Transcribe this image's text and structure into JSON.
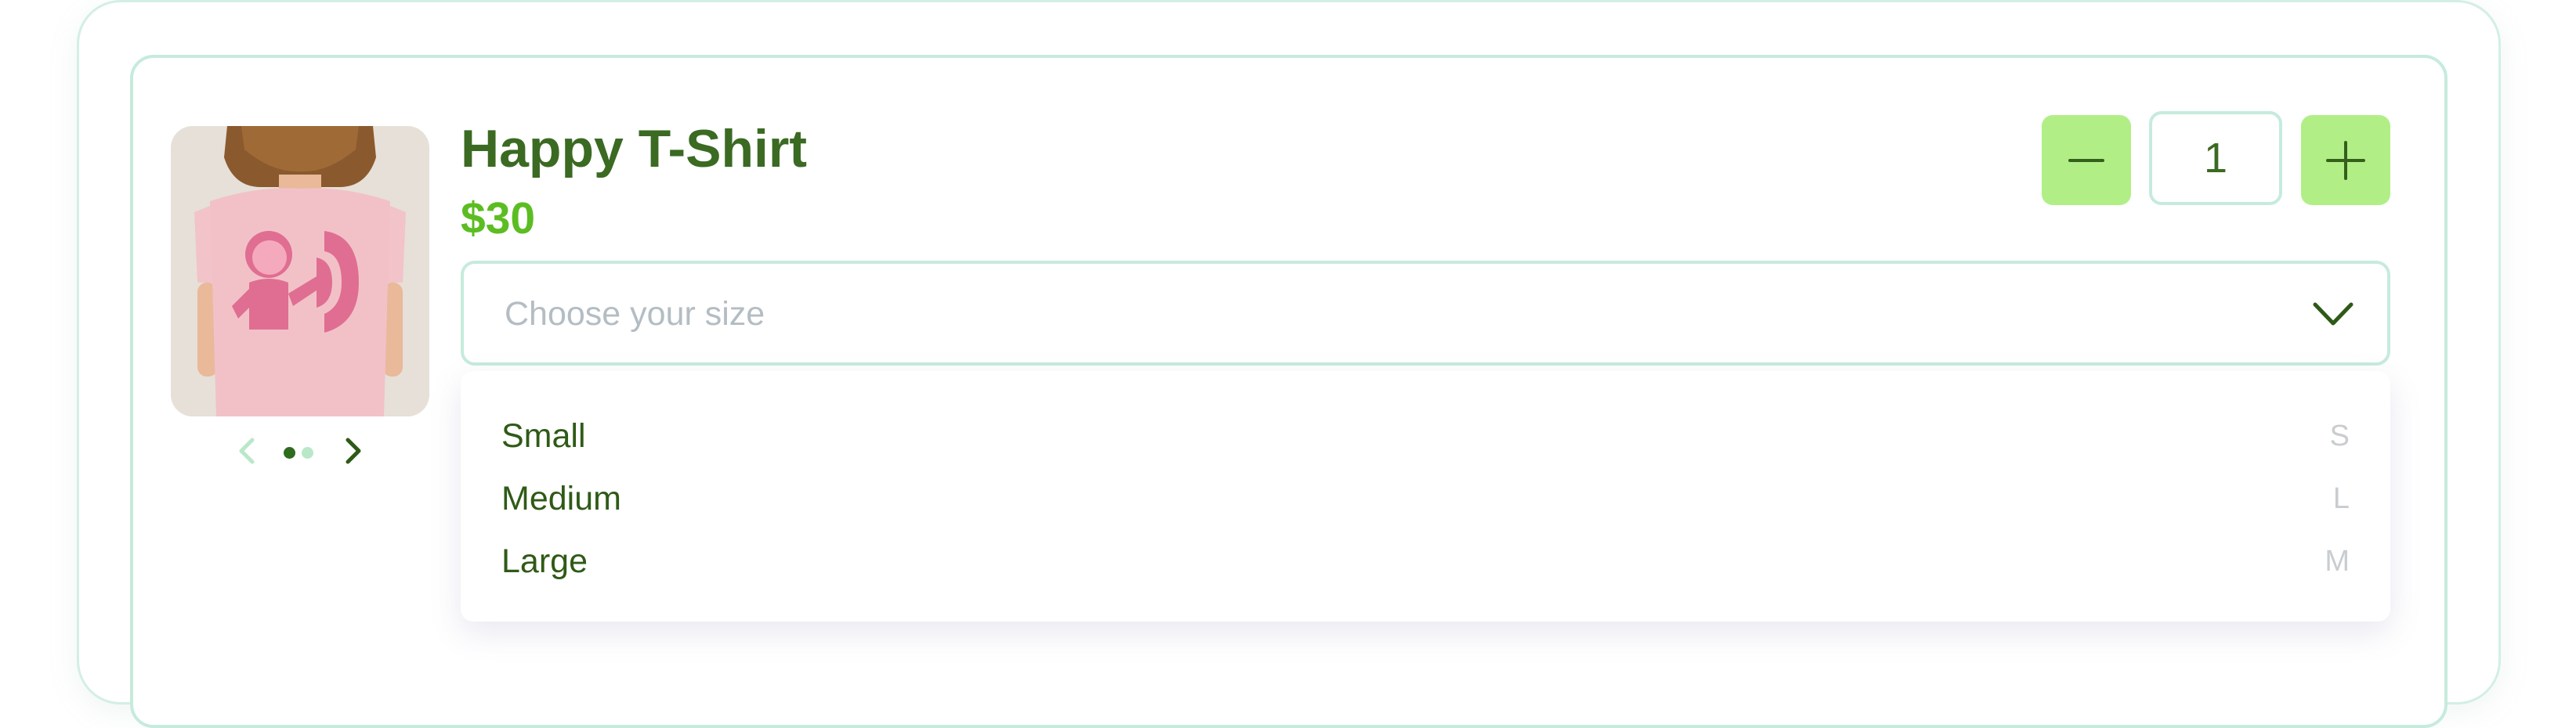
{
  "product": {
    "title": "Happy T-Shirt",
    "price": "$30",
    "image_icon": "pink-t-shirt-photo"
  },
  "carousel": {
    "prev_icon": "chevron-left-icon",
    "next_icon": "chevron-right-icon",
    "dot_count": 2,
    "active_index": 0
  },
  "quantity": {
    "value": "1",
    "minus_icon": "minus-icon",
    "plus_icon": "plus-icon"
  },
  "size_select": {
    "placeholder": "Choose your size",
    "chevron_icon": "chevron-down-icon",
    "options": [
      {
        "label": "Small",
        "code": "S"
      },
      {
        "label": "Medium",
        "code": "L"
      },
      {
        "label": "Large",
        "code": "M"
      }
    ]
  },
  "colors": {
    "title": "#3b6a22",
    "price": "#5cbd22",
    "button_bg": "#b1ef86",
    "border": "#c6ebdc",
    "placeholder": "#b3bdc3"
  }
}
